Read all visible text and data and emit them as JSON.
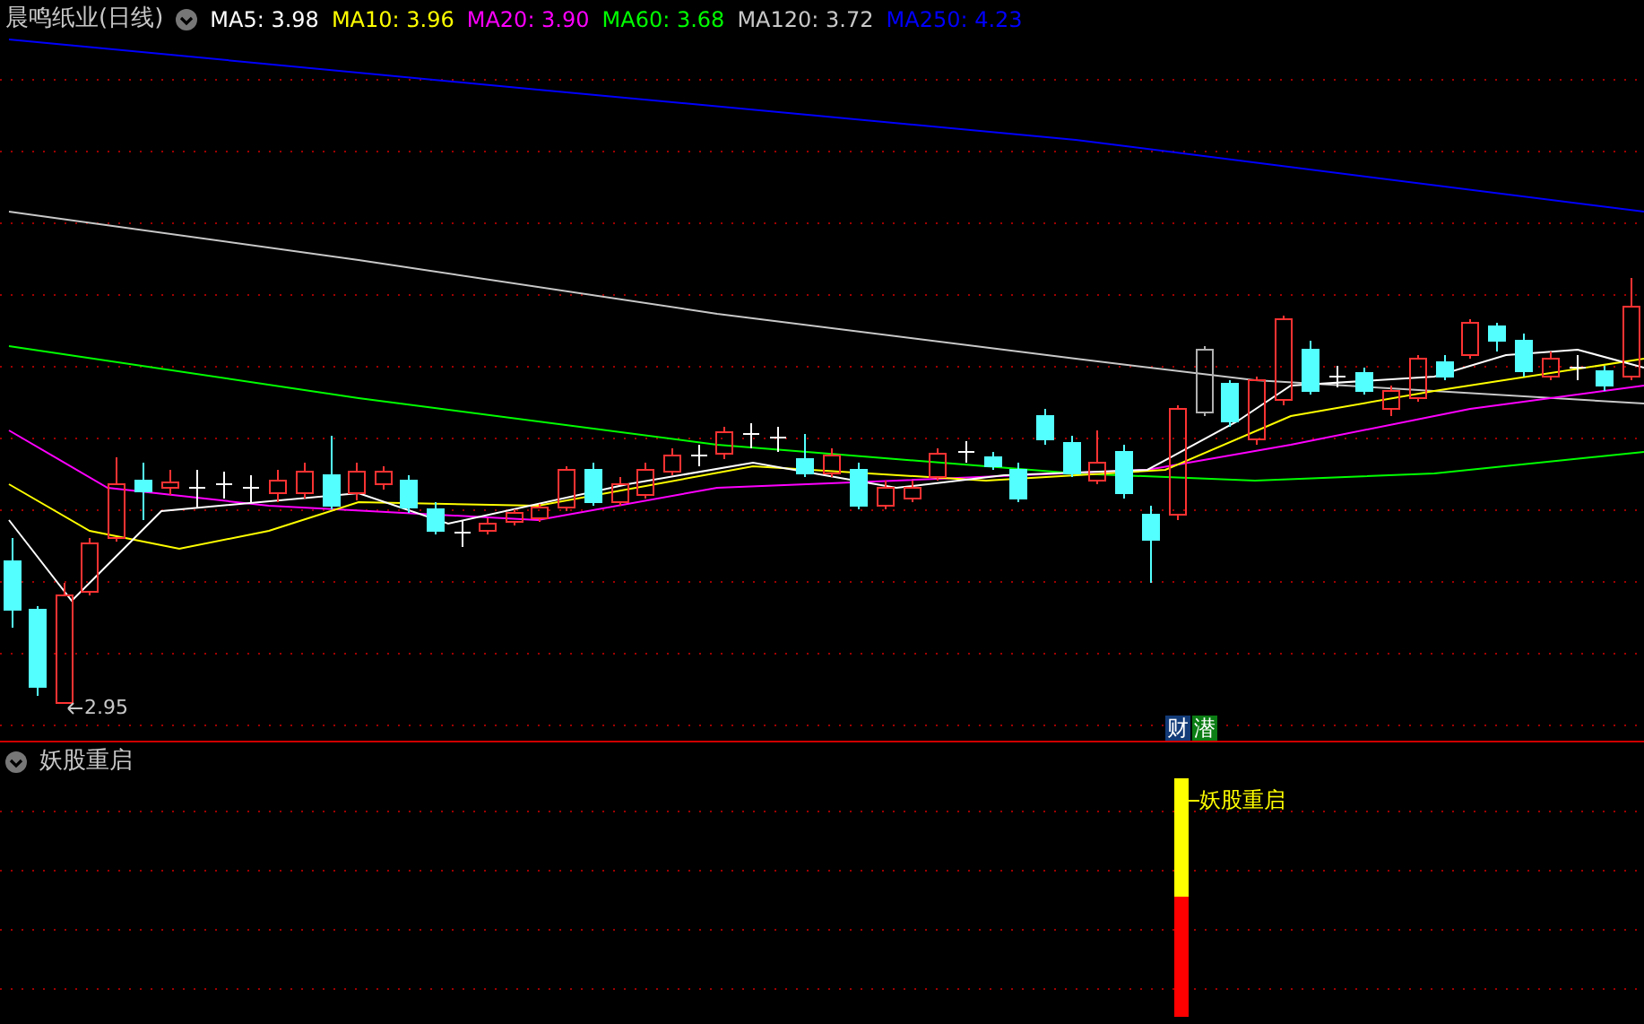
{
  "chart": {
    "title": "晨鸣纸业(日线)",
    "moving_averages": [
      {
        "label": "MA5: 3.98",
        "color": "#ffffff"
      },
      {
        "label": "MA10: 3.96",
        "color": "#ffff00"
      },
      {
        "label": "MA20: 3.90",
        "color": "#ff00ff"
      },
      {
        "label": "MA60: 3.68",
        "color": "#00ff00"
      },
      {
        "label": "MA120: 3.72",
        "color": "#c8c8c8"
      },
      {
        "label": "MA250: 4.23",
        "color": "#0000ff"
      }
    ],
    "low_label": "2.95",
    "markers": [
      {
        "text": "财",
        "color": "#123b78"
      },
      {
        "text": "潜",
        "color": "#0b7d14"
      }
    ]
  },
  "indicator": {
    "title": "妖股重启",
    "signal_label": "妖股重启"
  }
}
